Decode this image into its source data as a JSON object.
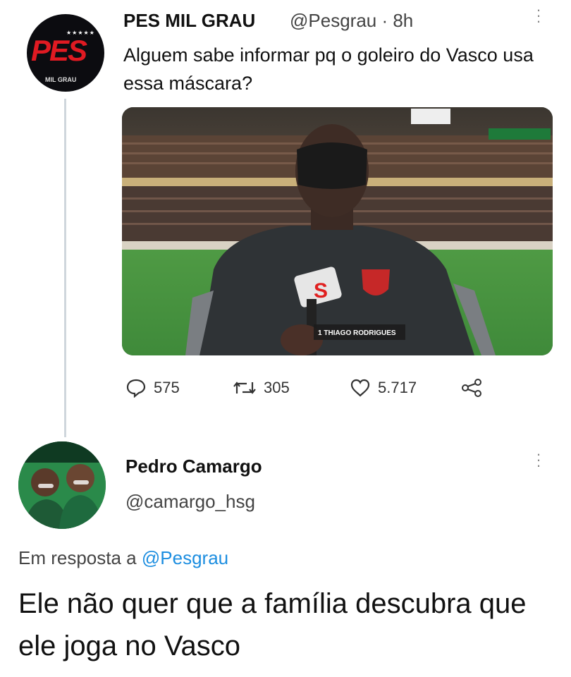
{
  "tweet": {
    "name": "PES MIL GRAU",
    "handle": "@Pesgrau · 8h",
    "text": "Alguem sabe informar pq o goleiro do Vasco usa essa máscara?",
    "avatar": {
      "logo_text": "PES",
      "sub_text": "MIL GRAU"
    },
    "media": {
      "caption_name": "THIAGO RODRIGUES",
      "caption_num": "1",
      "mic_label": "S",
      "brand_color": "#e02020",
      "pitch_color": "#3f8a3a"
    },
    "stats": {
      "replies": "575",
      "retweets": "305",
      "likes": "5.717"
    }
  },
  "reply_tweet": {
    "name": "Pedro Camargo",
    "handle": "@camargo_hsg",
    "reply_prefix": "Em resposta a",
    "reply_mention": "@Pesgrau",
    "text": "Ele não quer que a família descubra que ele joga no Vasco"
  },
  "colors": {
    "mention": "#1d8ee0",
    "thread_line": "#cfd6dc"
  }
}
